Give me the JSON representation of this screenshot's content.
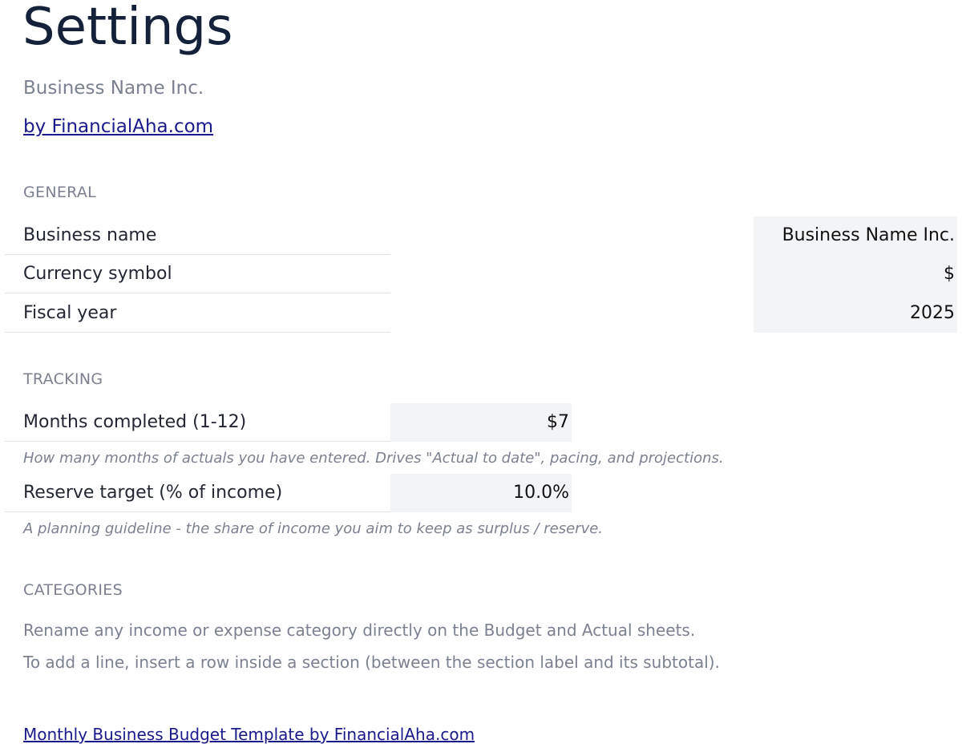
{
  "page": {
    "title": "Settings",
    "subtitle": "Business Name Inc.",
    "by_link": "by FinancialAha.com"
  },
  "general": {
    "heading": "GENERAL",
    "rows": [
      {
        "label": "Business name",
        "value": "Business Name Inc."
      },
      {
        "label": "Currency symbol",
        "value": "$"
      },
      {
        "label": "Fiscal year",
        "value": "2025"
      }
    ]
  },
  "tracking": {
    "heading": "TRACKING",
    "months": {
      "label": "Months completed (1-12)",
      "value": "$7",
      "help": "How many months of actuals you have entered. Drives \"Actual to date\", pacing, and projections."
    },
    "reserve": {
      "label": "Reserve target (% of income)",
      "value": "10.0%",
      "help": "A planning guideline - the share of income you aim to keep as surplus / reserve."
    }
  },
  "categories": {
    "heading": "CATEGORIES",
    "note1": "Rename any income or expense category directly on the Budget and Actual sheets.",
    "note2": "To add a line, insert a row inside a section (between the section label and its subtotal)."
  },
  "footer": {
    "link": "Monthly Business Budget Template by FinancialAha.com"
  },
  "colors": {
    "title": "#15213b",
    "muted": "#7b8190",
    "link": "#1a1a8c",
    "input_bg": "#f3f4f6"
  }
}
